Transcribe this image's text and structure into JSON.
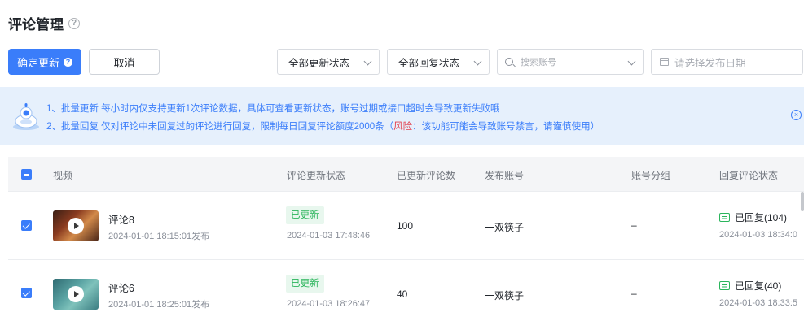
{
  "page": {
    "title": "评论管理",
    "help_glyph": "?"
  },
  "toolbar": {
    "confirm_label": "确定更新",
    "confirm_help": "?",
    "cancel_label": "取消",
    "update_status_filter": "全部更新状态",
    "reply_status_filter": "全部回复状态",
    "account_search_placeholder": "搜索账号",
    "date_placeholder": "请选择发布日期"
  },
  "notice": {
    "line1": "1、批量更新 每小时内仅支持更新1次评论数据，具体可查看更新状态，账号过期或接口超时会导致更新失败哦",
    "line2_prefix": "2、批量回复 仅对评论中未回复过的评论进行回复，限制每日回复评论额度2000条（",
    "line2_risk": "风险",
    "line2_suffix": "：该功能可能会导致账号禁言，请谨慎使用）",
    "close_glyph": "×"
  },
  "table": {
    "columns": {
      "video": "视频",
      "update_status": "评论更新状态",
      "updated_count": "已更新评论数",
      "account": "发布账号",
      "group": "账号分组",
      "reply_status": "回复评论状态"
    },
    "rows": [
      {
        "title": "评论8",
        "published": "2024-01-01 18:15:01发布",
        "status_tag": "已更新",
        "status_time": "2024-01-03 17:48:46",
        "count": "100",
        "account": "一双筷子",
        "group": "–",
        "reply": "已回复(104)",
        "reply_time": "2024-01-03 18:34:0"
      },
      {
        "title": "评论6",
        "published": "2024-01-01 18:25:01发布",
        "status_tag": "已更新",
        "status_time": "2024-01-03 18:26:47",
        "count": "40",
        "account": "一双筷子",
        "group": "–",
        "reply": "已回复(40)",
        "reply_time": "2024-01-03 18:33:5"
      }
    ]
  },
  "colors": {
    "primary": "#3a7dfa",
    "success": "#2bb55c",
    "danger": "#e23c4a",
    "notice_bg": "#e6f0fc"
  }
}
